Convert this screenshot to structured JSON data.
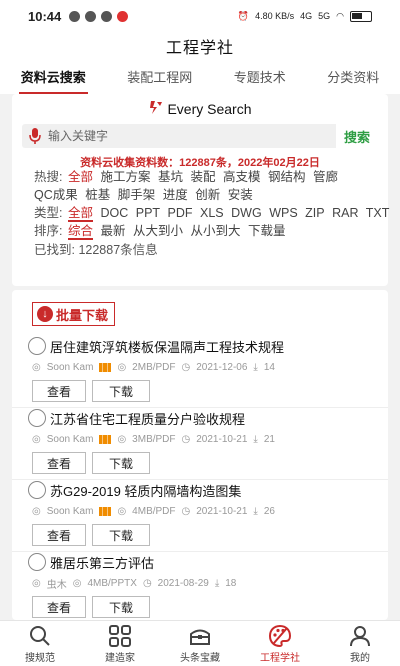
{
  "status": {
    "time": "10:44",
    "net_speed": "4.80 KB/s",
    "signal": "4G",
    "signal2": "5G"
  },
  "header": {
    "title": "工程学社"
  },
  "tabs": [
    {
      "label": "资料云搜索"
    },
    {
      "label": "装配工程网"
    },
    {
      "label": "专题技术"
    },
    {
      "label": "分类资料"
    }
  ],
  "brand": {
    "name": "Every Search"
  },
  "search": {
    "placeholder": "输入关键字",
    "button": "搜索"
  },
  "stat_line": "资料云收集资料数：122887条，2022年02月22日",
  "filters": {
    "hot": {
      "label": "热搜:",
      "items": [
        "全部",
        "施工方案",
        "基坑",
        "装配",
        "高支模",
        "钢结构",
        "管廊"
      ],
      "items2": [
        "QC成果",
        "桩基",
        "脚手架",
        "进度",
        "创新",
        "安装"
      ]
    },
    "type": {
      "label": "类型:",
      "items": [
        "全部",
        "DOC",
        "PPT",
        "PDF",
        "XLS",
        "DWG",
        "WPS",
        "ZIP",
        "RAR",
        "TXT"
      ]
    },
    "sort": {
      "label": "排序:",
      "items": [
        "综合",
        "最新",
        "从大到小",
        "从小到大",
        "下载量"
      ]
    },
    "found": "已找到: 122887条信息"
  },
  "batch_download": "批量下载",
  "results": [
    {
      "title": "居住建筑浮筑楼板保温隔声工程技术规程",
      "author": "Soon Kam",
      "size": "2MB/PDF",
      "date": "2021-12-06",
      "downloads": "14",
      "view": "查看",
      "download": "下载"
    },
    {
      "title": "江苏省住宅工程质量分户验收规程",
      "author": "Soon Kam",
      "size": "3MB/PDF",
      "date": "2021-10-21",
      "downloads": "21",
      "view": "查看",
      "download": "下载"
    },
    {
      "title": "苏G29-2019 轻质内隔墙构造图集",
      "author": "Soon Kam",
      "size": "4MB/PDF",
      "date": "2021-10-21",
      "downloads": "26",
      "view": "查看",
      "download": "下载"
    },
    {
      "title": "雅居乐第三方评估",
      "author": "虫木",
      "size": "4MB/PPTX",
      "date": "2021-08-29",
      "downloads": "18",
      "view": "查看",
      "download": "下载"
    }
  ],
  "nav": [
    {
      "label": "搜规范",
      "icon": "search-icon"
    },
    {
      "label": "建造家",
      "icon": "grid-icon"
    },
    {
      "label": "头条宝藏",
      "icon": "treasure-icon"
    },
    {
      "label": "工程学社",
      "icon": "palette-icon"
    },
    {
      "label": "我的",
      "icon": "user-icon"
    }
  ],
  "colors": {
    "accent": "#c92a2a",
    "search_button": "#2f9e44"
  }
}
